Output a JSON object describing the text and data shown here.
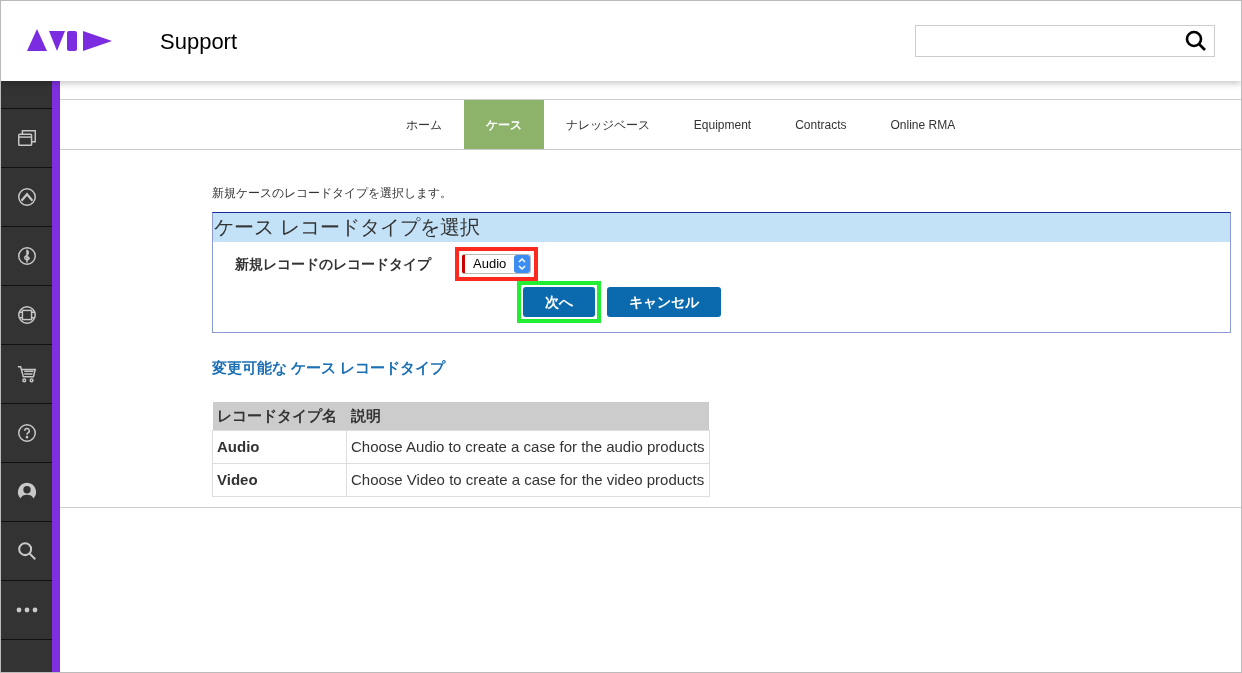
{
  "header": {
    "title": "Support"
  },
  "tabs": [
    {
      "label": "ホーム",
      "selected": false
    },
    {
      "label": "ケース",
      "selected": true
    },
    {
      "label": "ナレッジベース",
      "selected": false
    },
    {
      "label": "Equipment",
      "selected": false
    },
    {
      "label": "Contracts",
      "selected": false
    },
    {
      "label": "Online RMA",
      "selected": false
    }
  ],
  "intro": "新規ケースのレコードタイプを選択します。",
  "panel": {
    "title": "ケース レコードタイプを選択",
    "field_label": "新規レコードのレコードタイプ",
    "select": {
      "value": "Audio",
      "highlighted": true
    },
    "buttons": [
      {
        "label": "次へ",
        "highlighted": true
      },
      {
        "label": "キャンセル",
        "highlighted": false
      }
    ]
  },
  "link": "変更可能な ケース レコードタイプ",
  "table": {
    "columns": [
      "レコードタイプ名",
      "説明"
    ],
    "rows": [
      [
        "Audio",
        "Choose Audio to create a case for the audio products"
      ],
      [
        "Video",
        "Choose Video to create a case for the video products"
      ]
    ]
  }
}
